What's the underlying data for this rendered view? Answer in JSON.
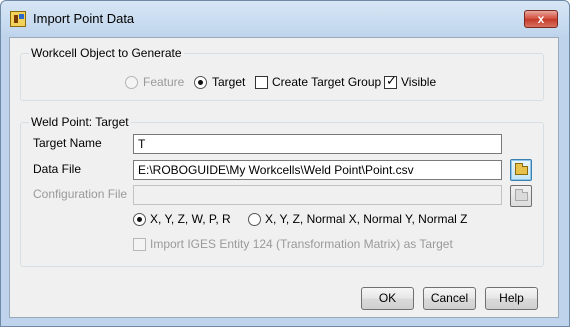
{
  "window": {
    "title": "Import Point Data",
    "close_glyph": "x"
  },
  "workcell_group": {
    "label": "Workcell Object to Generate",
    "options": [
      {
        "label": "Feature",
        "type": "radio",
        "checked": false,
        "enabled": false
      },
      {
        "label": "Target",
        "type": "radio",
        "checked": true,
        "enabled": true
      },
      {
        "label": "Create Target Group",
        "type": "checkbox",
        "checked": false,
        "enabled": true
      },
      {
        "label": "Visible",
        "type": "checkbox",
        "checked": true,
        "enabled": true
      }
    ]
  },
  "weld_group": {
    "label": "Weld Point: Target",
    "target_name": {
      "label": "Target Name",
      "value": "T"
    },
    "data_file": {
      "label": "Data File",
      "value": "E:\\ROBOGUIDE\\My Workcells\\Weld Point\\Point.csv"
    },
    "config_file": {
      "label": "Configuration File",
      "value": "",
      "enabled": false
    },
    "format_options": [
      {
        "label": "X, Y, Z, W, P, R",
        "checked": true
      },
      {
        "label": "X, Y, Z, Normal X, Normal Y, Normal Z",
        "checked": false
      }
    ],
    "iges_option": {
      "label": "Import IGES Entity 124 (Transformation Matrix) as Target",
      "checked": false,
      "enabled": false
    }
  },
  "buttons": {
    "ok": "OK",
    "cancel": "Cancel",
    "help": "Help"
  },
  "checkmark_glyph": "✓",
  "colors": {
    "title_gradient_top": "#d7e6f5",
    "client_bg": "#f0f0f0",
    "close_button": "#c23a2a",
    "disabled_text": "#9a9a9a"
  }
}
